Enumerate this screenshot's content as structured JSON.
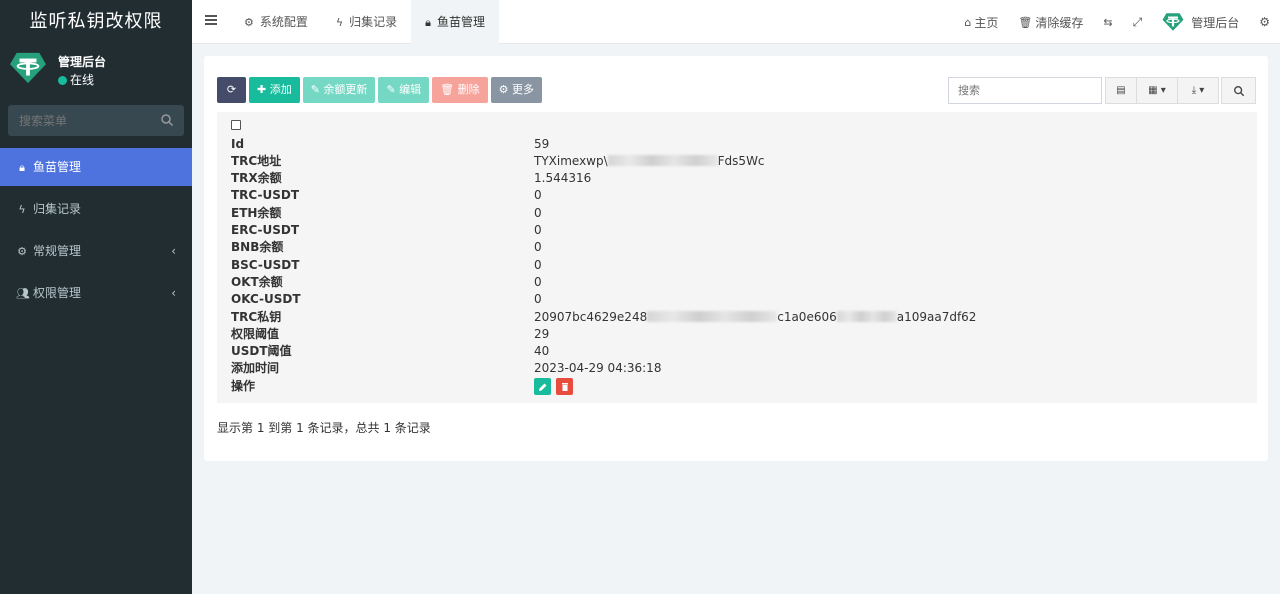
{
  "app": {
    "title": "监听私钥改权限",
    "brand_color": "#222d32",
    "accent": "#4e73df"
  },
  "user": {
    "name": "管理后台",
    "status": "在线",
    "avatar_icon": "tether-logo-icon"
  },
  "sidebar": {
    "search_placeholder": "搜索菜单",
    "items": [
      {
        "label": "鱼苗管理",
        "icon": "lock-icon",
        "active": true
      },
      {
        "label": "归集记录",
        "icon": "bolt-icon"
      },
      {
        "label": "常规管理",
        "icon": "cogs-icon",
        "expandable": true
      },
      {
        "label": "权限管理",
        "icon": "users-icon",
        "expandable": true
      }
    ]
  },
  "topnav": {
    "tabs": [
      {
        "label": "系统配置",
        "icon": "gear-icon"
      },
      {
        "label": "归集记录",
        "icon": "bolt-icon"
      },
      {
        "label": "鱼苗管理",
        "icon": "lock-icon",
        "active": true
      }
    ],
    "right": {
      "home": "主页",
      "clear_cache": "清除缓存",
      "admin": "管理后台"
    }
  },
  "toolbar": {
    "add": "添加",
    "balance_update": "余额更新",
    "edit": "编辑",
    "delete": "删除",
    "more": "更多",
    "search_placeholder": "搜索"
  },
  "record": {
    "fields": [
      {
        "key": "Id",
        "value": "59"
      },
      {
        "key": "TRC地址",
        "value_prefix": "TYXimexwp\\",
        "value_suffix": "Fds5Wc"
      },
      {
        "key": "TRX余额",
        "value": "1.544316"
      },
      {
        "key": "TRC-USDT",
        "value": "0"
      },
      {
        "key": "ETH余额",
        "value": "0"
      },
      {
        "key": "ERC-USDT",
        "value": "0"
      },
      {
        "key": "BNB余额",
        "value": "0"
      },
      {
        "key": "BSC-USDT",
        "value": "0"
      },
      {
        "key": "OKT余额",
        "value": "0"
      },
      {
        "key": "OKC-USDT",
        "value": "0"
      },
      {
        "key": "TRC私钥",
        "value_prefix": "20907bc4629e248",
        "value_mid": "c1a0e606",
        "value_suffix": "a109aa7df62"
      },
      {
        "key": "权限阈值",
        "value": "29"
      },
      {
        "key": "USDT阈值",
        "value": "40"
      },
      {
        "key": "添加时间",
        "value": "2023-04-29 04:36:18"
      },
      {
        "key": "操作"
      }
    ]
  },
  "pagination": {
    "summary": "显示第 1 到第 1 条记录，总共 1 条记录"
  }
}
